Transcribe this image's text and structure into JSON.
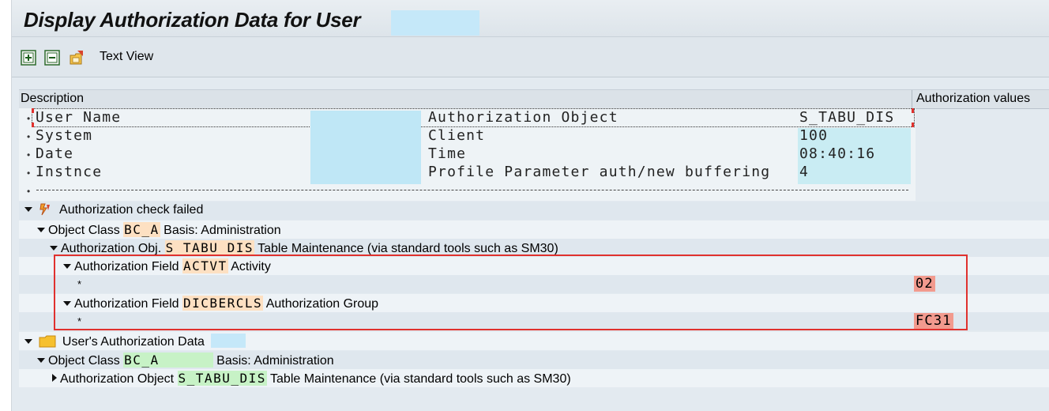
{
  "window": {
    "title": "Display Authorization Data for User"
  },
  "toolbar": {
    "text_view_label": "Text View",
    "icons": [
      "expand-all-icon",
      "collapse-all-icon",
      "folder-share-icon"
    ]
  },
  "columns": {
    "description": "Description",
    "values": "Authorization values"
  },
  "info": {
    "rows": [
      {
        "label": "User Name",
        "key": "Authorization Object",
        "value": "S_TABU_DIS"
      },
      {
        "label": "System",
        "key": "Client",
        "value": "100"
      },
      {
        "label": "Date",
        "key": "Time",
        "value": "08:40:16"
      },
      {
        "label": "Instnce",
        "key": "Profile Parameter auth/new buffering",
        "value": "4"
      }
    ],
    "divider": "------------------------------------------------------------------------------------------------------------"
  },
  "tree": {
    "failed": {
      "label": "Authorization check failed"
    },
    "obj_class_1": {
      "prefix": "Object Class",
      "code": "BC_A",
      "suffix": "Basis: Administration"
    },
    "auth_obj_1": {
      "prefix": "Authorization Obj.",
      "code": "S_TABU_DIS",
      "suffix": "Table Maintenance (via standard tools such as SM30)"
    },
    "field_1": {
      "prefix": "Authorization Field",
      "code": "ACTVT",
      "suffix": "Activity",
      "value_star": "*",
      "value": "02"
    },
    "field_2": {
      "prefix": "Authorization Field",
      "code": "DICBERCLS",
      "suffix": "Authorization Group",
      "value_star": "*",
      "value": "FC31"
    },
    "user_data": {
      "label": "User's Authorization Data"
    },
    "obj_class_2": {
      "prefix": "Object Class",
      "code": "BC_A",
      "suffix": "Basis: Administration"
    },
    "auth_obj_2": {
      "prefix": "Authorization Object",
      "code": "S_TABU_DIS",
      "suffix": "Table Maintenance (via standard tools such as SM30)"
    }
  },
  "colors": {
    "highlight_orange": "#fde0c2",
    "highlight_green": "#c7f2c6",
    "error_value": "#f29a8e",
    "frame_red": "#e0312e",
    "mask_blue": "#bfe7f6"
  }
}
